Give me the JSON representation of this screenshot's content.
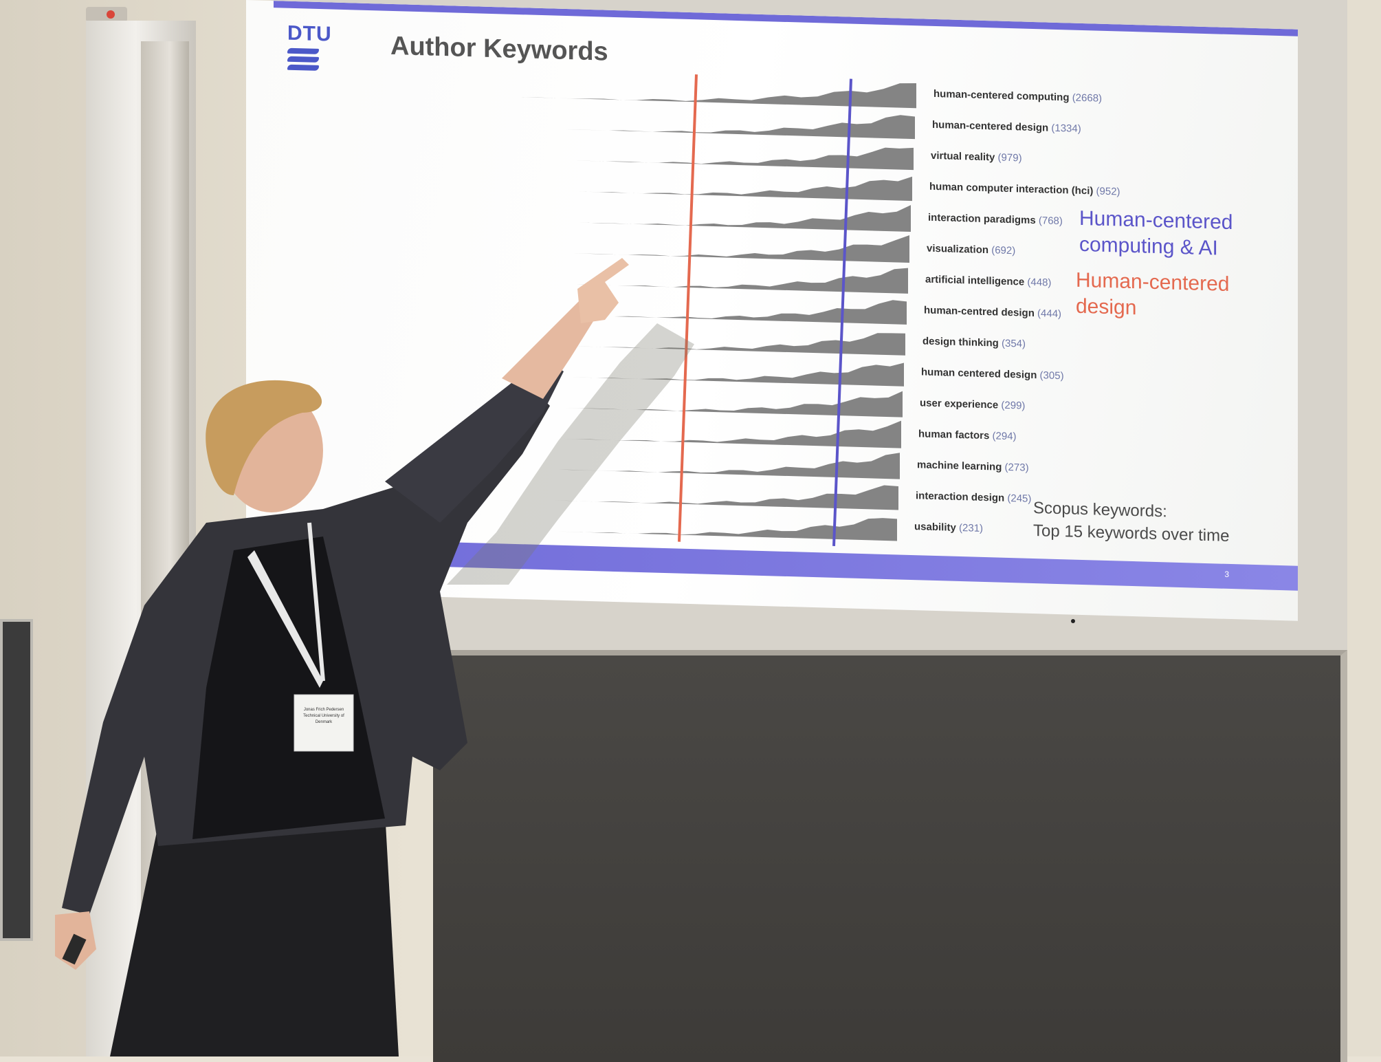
{
  "slide": {
    "logo_text": "DTU",
    "title": "Author Keywords",
    "page_number": "3",
    "legend": {
      "ai_label": "Human-centered computing & AI",
      "hcd_label": "Human-centered design",
      "ai_color": "#5b55c9",
      "hcd_color": "#e4694f"
    },
    "scopus_note_line1": "Scopus keywords:",
    "scopus_note_line2": "Top 15 keywords over time",
    "accent_color": "#6f6ad8"
  },
  "chart_data": {
    "type": "area",
    "title": "Author Keywords",
    "series": [
      {
        "keyword": "human-centered computing",
        "count_label": "(2668)",
        "count": 2668
      },
      {
        "keyword": "human-centered design",
        "count_label": "(1334)",
        "count": 1334
      },
      {
        "keyword": "virtual reality",
        "count_label": "(979)",
        "count": 979
      },
      {
        "keyword": "human computer interaction (hci)",
        "count_label": "(952)",
        "count": 952
      },
      {
        "keyword": "interaction paradigms",
        "count_label": "(768)",
        "count": 768
      },
      {
        "keyword": "visualization",
        "count_label": "(692)",
        "count": 692
      },
      {
        "keyword": "artificial intelligence",
        "count_label": "(448)",
        "count": 448
      },
      {
        "keyword": "human-centred design",
        "count_label": "(444)",
        "count": 444
      },
      {
        "keyword": "design thinking",
        "count_label": "(354)",
        "count": 354
      },
      {
        "keyword": "human centered design",
        "count_label": "(305)",
        "count": 305
      },
      {
        "keyword": "user experience",
        "count_label": "(299)",
        "count": 299
      },
      {
        "keyword": "human factors",
        "count_label": "(294)",
        "count": 294
      },
      {
        "keyword": "machine learning",
        "count_label": "(273)",
        "count": 273
      },
      {
        "keyword": "interaction design",
        "count_label": "(245)",
        "count": 245
      },
      {
        "keyword": "usability",
        "count_label": "(231)",
        "count": 231
      }
    ],
    "reference_lines": [
      {
        "color": "#e4694f"
      },
      {
        "color": "#5b55c9"
      }
    ]
  },
  "badge": {
    "line1": "Jonas Frich Pedersen",
    "line2": "Technical University of Denmark"
  }
}
